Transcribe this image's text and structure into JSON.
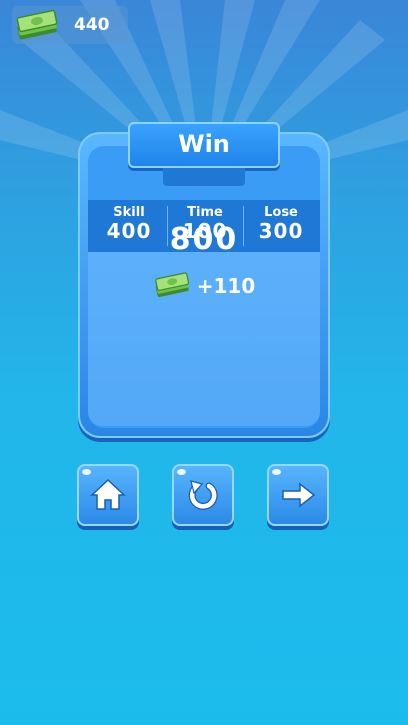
{
  "hud": {
    "cash": "440"
  },
  "result": {
    "title": "Win",
    "stats": [
      {
        "label": "Skill",
        "value": "400"
      },
      {
        "label": "Time",
        "value": "100"
      },
      {
        "label": "Lose",
        "value": "300"
      }
    ],
    "score": "800",
    "bonus": "+110"
  },
  "buttons": [
    {
      "icon": "home-icon"
    },
    {
      "icon": "restart-icon"
    },
    {
      "icon": "next-arrow-icon"
    }
  ],
  "colors": {
    "panel": "#2a86e6",
    "stats_bar": "#1f78d6",
    "background": "#22b6ea"
  }
}
